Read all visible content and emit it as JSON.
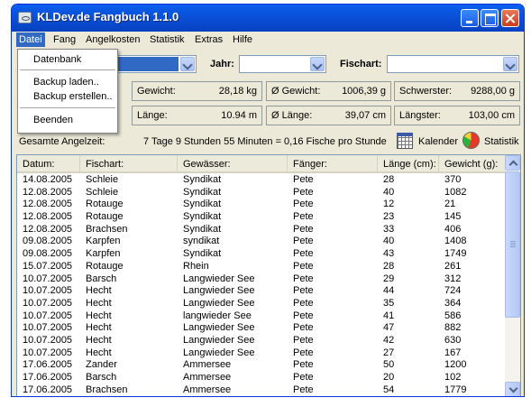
{
  "window": {
    "title": "KLDev.de Fangbuch 1.1.0"
  },
  "menu": [
    "Datei",
    "Fang",
    "Angelkosten",
    "Statistik",
    "Extras",
    "Hilfe"
  ],
  "file_menu": [
    "Datenbank",
    "Backup laden..",
    "Backup erstellen..",
    "Beenden"
  ],
  "filters": {
    "jahr_label": "Jahr:",
    "fischart_label": "Fischart:"
  },
  "stats": {
    "gewicht_label": "Gewicht:",
    "gewicht": "28,18 kg",
    "avg_gewicht_label": "Ø Gewicht:",
    "avg_gewicht": "1006,39 g",
    "schwerster_label": "Schwerster:",
    "schwerster": "9288,00 g",
    "laenge_label": "Länge:",
    "laenge": "10.94 m",
    "avg_laenge_label": "Ø Länge:",
    "avg_laenge": "39,07 cm",
    "laengster_label": "Längster:",
    "laengster": "103,00 cm"
  },
  "summary": {
    "label": "Gesamte Angelzeit:",
    "value": "7 Tage 9 Stunden 55 Minuten  =  0,16 Fische pro Stunde",
    "kalender": "Kalender",
    "statistik": "Statistik"
  },
  "table": {
    "columns": [
      "Datum:",
      "Fischart:",
      "Gewässer:",
      "Fänger:",
      "Länge (cm):",
      "Gewicht (g):"
    ],
    "rows": [
      [
        "14.08.2005",
        "Schleie",
        "Syndikat",
        "Pete",
        "28",
        "370"
      ],
      [
        "12.08.2005",
        "Schleie",
        "Syndikat",
        "Pete",
        "40",
        "1082"
      ],
      [
        "12.08.2005",
        "Rotauge",
        "Syndikat",
        "Pete",
        "12",
        "21"
      ],
      [
        "12.08.2005",
        "Rotauge",
        "Syndikat",
        "Pete",
        "23",
        "145"
      ],
      [
        "12.08.2005",
        "Brachsen",
        "Syndikat",
        "Pete",
        "33",
        "406"
      ],
      [
        "09.08.2005",
        "Karpfen",
        "syndikat",
        "Pete",
        "40",
        "1408"
      ],
      [
        "09.08.2005",
        "Karpfen",
        "Syndikat",
        "Pete",
        "43",
        "1749"
      ],
      [
        "15.07.2005",
        "Rotauge",
        "Rhein",
        "Pete",
        "28",
        "261"
      ],
      [
        "10.07.2005",
        "Barsch",
        "Langwieder See",
        "Pete",
        "29",
        "312"
      ],
      [
        "10.07.2005",
        "Hecht",
        "Langwieder See",
        "Pete",
        "44",
        "724"
      ],
      [
        "10.07.2005",
        "Hecht",
        "Langwieder See",
        "Pete",
        "35",
        "364"
      ],
      [
        "10.07.2005",
        "Hecht",
        "langwieder See",
        "Pete",
        "41",
        "586"
      ],
      [
        "10.07.2005",
        "Hecht",
        "Langwieder See",
        "Pete",
        "47",
        "882"
      ],
      [
        "10.07.2005",
        "Hecht",
        "Langwieder See",
        "Pete",
        "42",
        "630"
      ],
      [
        "10.07.2005",
        "Hecht",
        "Langwieder See",
        "Pete",
        "27",
        "167"
      ],
      [
        "17.06.2005",
        "Zander",
        "Ammersee",
        "Pete",
        "50",
        "1200"
      ],
      [
        "17.06.2005",
        "Barsch",
        "Ammersee",
        "Pete",
        "20",
        "102"
      ],
      [
        "17.06.2005",
        "Brachsen",
        "Ammersee",
        "Pete",
        "54",
        "1779"
      ]
    ]
  }
}
